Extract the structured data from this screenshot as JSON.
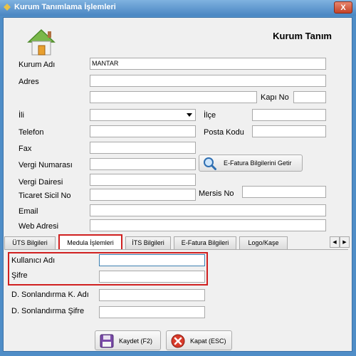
{
  "window": {
    "title": "Kurum Tanımlama İşlemleri",
    "close_label": "X"
  },
  "header": {
    "title": "Kurum Tanım",
    "icon": "house-icon"
  },
  "form": {
    "kurum_adi": {
      "label": "Kurum Adı",
      "value": "MANTAR"
    },
    "adres": {
      "label": "Adres",
      "value": "",
      "value2": ""
    },
    "kapi_no": {
      "label": "Kapı No",
      "value": ""
    },
    "ili": {
      "label": "İli",
      "value": ""
    },
    "ilce": {
      "label": "İlçe",
      "value": ""
    },
    "telefon": {
      "label": "Telefon",
      "value": ""
    },
    "posta_kodu": {
      "label": "Posta Kodu",
      "value": ""
    },
    "fax": {
      "label": "Fax",
      "value": ""
    },
    "vergi_numarasi": {
      "label": "Vergi Numarası",
      "value": ""
    },
    "efatura_button": {
      "label": "E-Fatura Bilgilerini Getir",
      "icon": "magnifier-icon"
    },
    "vergi_dairesi": {
      "label": "Vergi Dairesi",
      "value": ""
    },
    "ticaret_sicil_no": {
      "label": "Ticaret Sicil No",
      "value": ""
    },
    "mersis_no": {
      "label": "Mersis No",
      "value": ""
    },
    "email": {
      "label": "Email",
      "value": ""
    },
    "web_adresi": {
      "label": "Web Adresi",
      "value": ""
    }
  },
  "tabs": [
    {
      "label": "ÜTS Bilgileri"
    },
    {
      "label": "Medula İşlemleri",
      "active": true
    },
    {
      "label": "İTS Bilgileri"
    },
    {
      "label": "E-Fatura Bilgileri"
    },
    {
      "label": "Logo/Kaşe"
    }
  ],
  "medula": {
    "kullanici_adi": {
      "label": "Kullanıcı Adı",
      "value": ""
    },
    "sifre": {
      "label": "Şifre",
      "value": ""
    },
    "d_sonlandirma_kadi": {
      "label": "D. Sonlandırma K. Adı",
      "value": ""
    },
    "d_sonlandirma_sifre": {
      "label": "D. Sonlandırma Şifre",
      "value": ""
    }
  },
  "footer": {
    "save_label": "Kaydet (F2)",
    "save_icon": "floppy-disk-icon",
    "close_label": "Kapat (ESC)",
    "close_icon": "cancel-icon"
  },
  "colors": {
    "highlight": "#d02020",
    "titlebar": "#4f8dc7"
  }
}
